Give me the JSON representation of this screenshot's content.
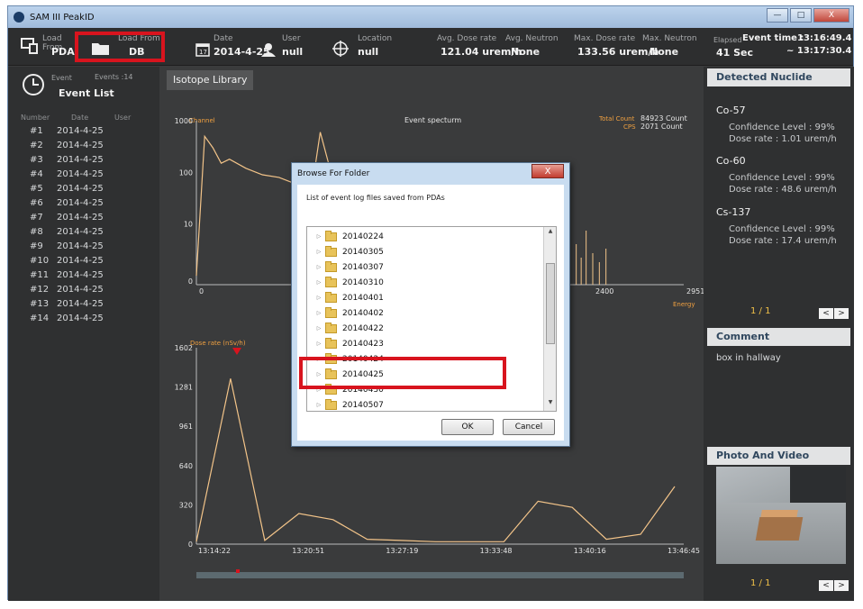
{
  "window": {
    "title": "SAM III PeakID",
    "buttons": [
      "—",
      "□",
      "X"
    ]
  },
  "toolbar": {
    "load_pda": {
      "label": "Load From",
      "value": "PDA"
    },
    "load_db": {
      "label": "Load From",
      "value": "DB"
    },
    "date": {
      "label": "Date",
      "value": "2014-4-25",
      "icon_day": "17"
    },
    "user": {
      "label": "User",
      "value": "null"
    },
    "location": {
      "label": "Location",
      "value": "null"
    },
    "avg_dose": {
      "label": "Avg. Dose rate",
      "value": "121.04 urem/h"
    },
    "avg_neutron": {
      "label": "Avg. Neutron",
      "value": "None"
    },
    "max_dose": {
      "label": "Max. Dose rate",
      "value": "133.56 urem/h"
    },
    "max_neutron": {
      "label": "Max. Neutron",
      "value": "None"
    },
    "elapsed": {
      "label": "Elapsed",
      "value": "41 Sec"
    },
    "event_time": {
      "label": "Event time :",
      "start": "13:16:49.4",
      "end": "~ 13:17:30.4"
    }
  },
  "event_panel": {
    "label": "Event",
    "count_label": "Events :14",
    "title": "Event List",
    "columns": [
      "Number",
      "Date",
      "User"
    ],
    "events": [
      {
        "num": "#1",
        "date": "2014-4-25"
      },
      {
        "num": "#2",
        "date": "2014-4-25"
      },
      {
        "num": "#3",
        "date": "2014-4-25"
      },
      {
        "num": "#4",
        "date": "2014-4-25"
      },
      {
        "num": "#5",
        "date": "2014-4-25"
      },
      {
        "num": "#6",
        "date": "2014-4-25"
      },
      {
        "num": "#7",
        "date": "2014-4-25"
      },
      {
        "num": "#8",
        "date": "2014-4-25"
      },
      {
        "num": "#9",
        "date": "2014-4-25"
      },
      {
        "num": "#10",
        "date": "2014-4-25"
      },
      {
        "num": "#11",
        "date": "2014-4-25"
      },
      {
        "num": "#12",
        "date": "2014-4-25"
      },
      {
        "num": "#13",
        "date": "2014-4-25"
      },
      {
        "num": "#14",
        "date": "2014-4-25"
      }
    ]
  },
  "main": {
    "isotope_button": "Isotope Library",
    "spectrum": {
      "title": "Event specturm",
      "channel_label": "Channel",
      "energy_label": "Energy",
      "total_count": "Total Count",
      "total_count_value": "84923 Count",
      "cps": "CPS",
      "cps_value": "2071 Count",
      "yticks": [
        "1000",
        "100",
        "10",
        "0"
      ],
      "xticks": [
        "0",
        "2400",
        "2951"
      ]
    },
    "doserate": {
      "title": "Dose rate (nSv/h)",
      "yticks": [
        "1602",
        "1281",
        "961",
        "640",
        "320",
        "0"
      ],
      "xticks": [
        "13:14:22",
        "13:20:51",
        "13:27:19",
        "13:33:48",
        "13:40:16",
        "13:46:45"
      ]
    }
  },
  "chart_data": [
    {
      "type": "line",
      "title": "Event specturm",
      "xlabel": "Energy",
      "ylabel": "Channel",
      "yscale": "log",
      "ylim": [
        0,
        1000
      ],
      "xlim": [
        0,
        2951
      ],
      "series": [
        {
          "x": [
            0,
            50,
            100,
            150,
            200,
            300,
            400,
            500,
            600,
            700,
            750,
            800,
            900
          ],
          "values": [
            0,
            500,
            300,
            150,
            180,
            120,
            90,
            80,
            60,
            50,
            600,
            150,
            40
          ]
        }
      ]
    },
    {
      "type": "line",
      "title": "Dose rate (nSv/h)",
      "ylim": [
        0,
        1602
      ],
      "categories": [
        "13:14:22",
        "13:20:51",
        "13:27:19",
        "13:33:48",
        "13:40:16",
        "13:46:45"
      ],
      "series": [
        {
          "values": [
            20,
            1350,
            30,
            250,
            200,
            40,
            30,
            20,
            20,
            20,
            350,
            300,
            40,
            80,
            470
          ]
        }
      ]
    }
  ],
  "right_panel": {
    "detected_title": "Detected Nuclide",
    "nuclides": [
      {
        "name": "Co-57",
        "confidence": "Confidence Level : 99%",
        "dose": "Dose rate : 1.01 urem/h"
      },
      {
        "name": "Co-60",
        "confidence": "Confidence Level : 99%",
        "dose": "Dose rate : 48.6 urem/h"
      },
      {
        "name": "Cs-137",
        "confidence": "Confidence Level : 99%",
        "dose": "Dose rate : 17.4 urem/h"
      }
    ],
    "nuclide_pager": "1 / 1",
    "comment_title": "Comment",
    "comment": "box in hallway",
    "photo_title": "Photo And Video",
    "photo_pager": "1 / 1"
  },
  "dialog": {
    "title": "Browse For Folder",
    "close": "X",
    "description": "List of event log files saved from PDAs",
    "folders": [
      "20140224",
      "20140305",
      "20140307",
      "20140310",
      "20140401",
      "20140402",
      "20140422",
      "20140423",
      "20140424",
      "20140425",
      "20140430",
      "20140507"
    ],
    "ok": "OK",
    "cancel": "Cancel"
  },
  "colors": {
    "highlight": "#d8141e",
    "accent": "#f0a040",
    "panel": "#2f3031"
  }
}
